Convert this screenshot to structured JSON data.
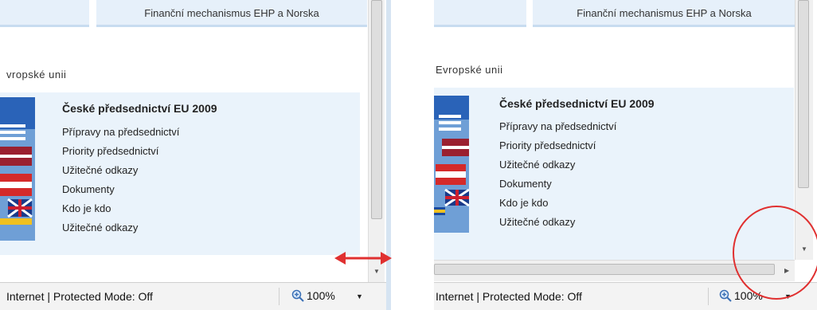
{
  "left": {
    "tab_label": "Finanční mechanismus EHP a Norska",
    "section_title": "vropské unii",
    "box_heading": "České předsednictví EU 2009",
    "links": [
      "Přípravy na předsednictví",
      "Priority předsednictví",
      "Užitečné odkazy",
      "Dokumenty",
      "Kdo je kdo",
      "Užitečné odkazy"
    ],
    "status_text": "Internet | Protected Mode: Off",
    "zoom": "100%"
  },
  "right": {
    "tab_label": "Finanční mechanismus EHP a Norska",
    "section_title": "Evropské unii",
    "box_heading": "České předsednictví EU 2009",
    "links": [
      "Přípravy na předsednictví",
      "Priority předsednictví",
      "Užitečné odkazy",
      "Dokumenty",
      "Kdo je kdo",
      "Užitečné odkazy"
    ],
    "status_text": "Internet | Protected Mode: Off",
    "zoom": "100%"
  },
  "icons": {
    "zoom": "magnifier-plus-icon",
    "dropdown": "triangle-down-icon",
    "scroll_down": "arrow-down-icon",
    "scroll_right": "arrow-right-icon",
    "resize": "double-arrow-icon"
  },
  "colors": {
    "tab_bg": "#e6f0fa",
    "box_bg": "#eaf3fb",
    "annotation_red": "#e03030"
  }
}
